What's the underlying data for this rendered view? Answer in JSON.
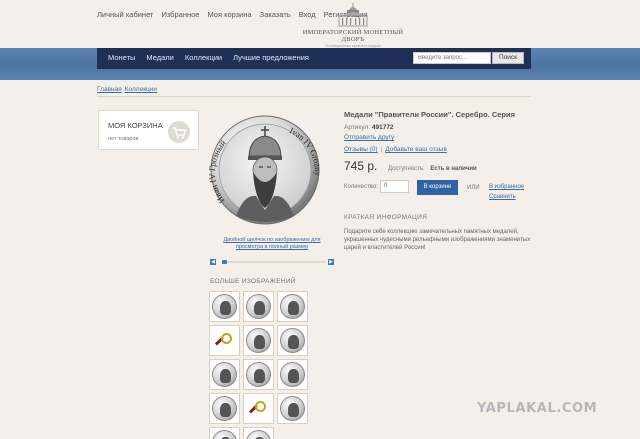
{
  "top_links": [
    "Личный кабинет",
    "Избранное",
    "Моя корзина",
    "Заказать",
    "Вход",
    "Регистрация"
  ],
  "logo": {
    "name": "ИМПЕРАТОРСКИЙ МОНЕТНЫЙ ДВОРЪ",
    "tagline": "Коллекционные монеты и медали"
  },
  "menu": [
    "Монеты",
    "Медали",
    "Коллекции",
    "Лучшие предложения"
  ],
  "search": {
    "placeholder": "Введите запрос...",
    "button": "Поиск"
  },
  "breadcrumbs": [
    "Главная",
    "Коллекции"
  ],
  "cart": {
    "title": "МОЯ КОРЗИНА",
    "status": "нет товаров"
  },
  "coin": {
    "left_text": "Иван IV Грозный",
    "right_text": "Ivan IV Grozny"
  },
  "image_hint": "Двойной щелчок по изображению для просмотра в полный размер",
  "more_images_title": "БОЛЬШЕ ИЗОБРАЖЕНИЙ",
  "thumbnails": [
    "coin",
    "coin",
    "coin",
    "magnifier",
    "coin",
    "coin",
    "coin",
    "coin",
    "coin",
    "coin",
    "magnifier",
    "coin",
    "coin",
    "coin"
  ],
  "product": {
    "title": "Медали \"Правители России\". Серебро. Серия",
    "article_label": "Артикул:",
    "article_value": "491772",
    "send_friend": "Отправить другу",
    "reviews": "Отзывы (0)",
    "add_review": "Добавьте ваш отзыв",
    "price": "745 р.",
    "availability_label": "Доступность:",
    "availability_value": "Есть в наличии",
    "qty_label": "Количество:",
    "qty_value": "0",
    "add_to_cart": "В корзине",
    "or": "ИЛИ",
    "add_favorites": "В избранное",
    "compare": "Сравнить",
    "info_heading": "КРАТКАЯ ИНФОРМАЦИЯ",
    "description": "Подарите себе коллекцию замечательных памятных медалей, украшенных чудесными рельефными изображениями знаменитых царей и властителей России!"
  },
  "watermark": "YAPLAKAL.COM",
  "colors": {
    "menu_bar": "#1f2f55",
    "accent": "#2f63a6",
    "page_bg": "#f4efe9"
  }
}
